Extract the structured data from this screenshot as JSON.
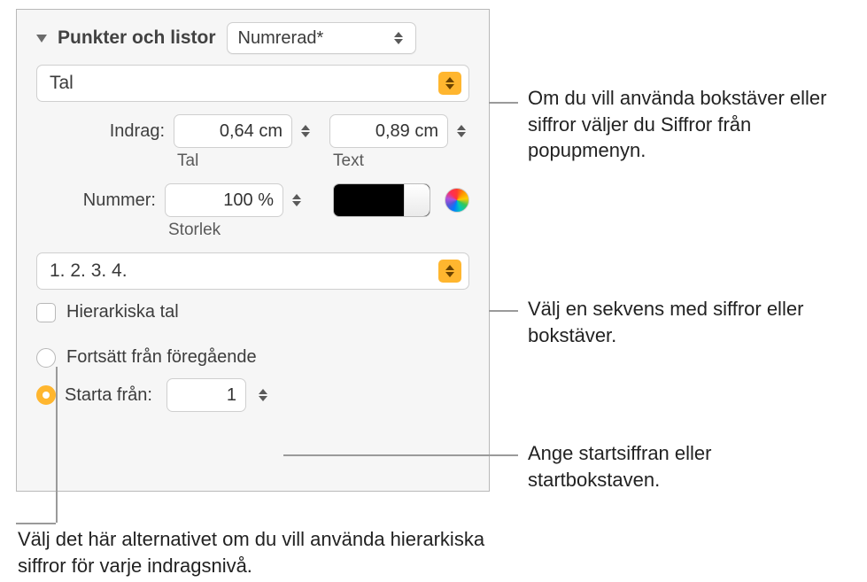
{
  "section": {
    "title": "Punkter och listor",
    "style_popup": "Numrerad*"
  },
  "type_popup": "Tal",
  "indent": {
    "label": "Indrag:",
    "number_value": "0,64 cm",
    "number_sub": "Tal",
    "text_value": "0,89 cm",
    "text_sub": "Text"
  },
  "number": {
    "label": "Nummer:",
    "size_value": "100 %",
    "size_sub": "Storlek"
  },
  "sequence_popup": "1. 2. 3. 4.",
  "hierarchical": {
    "label": "Hierarkiska tal"
  },
  "continue": {
    "label": "Fortsätt från föregående"
  },
  "start_from": {
    "label": "Starta från:",
    "value": "1"
  },
  "callouts": {
    "type": "Om du vill använda bokstäver eller siffror väljer du Siffror från popupmenyn.",
    "sequence": "Välj en sekvens med siffror eller bokstäver.",
    "start": "Ange startsiffran eller startbokstaven.",
    "hier": "Välj det här alternativet om du vill använda hierarkiska siffror för varje indragsnivå."
  }
}
